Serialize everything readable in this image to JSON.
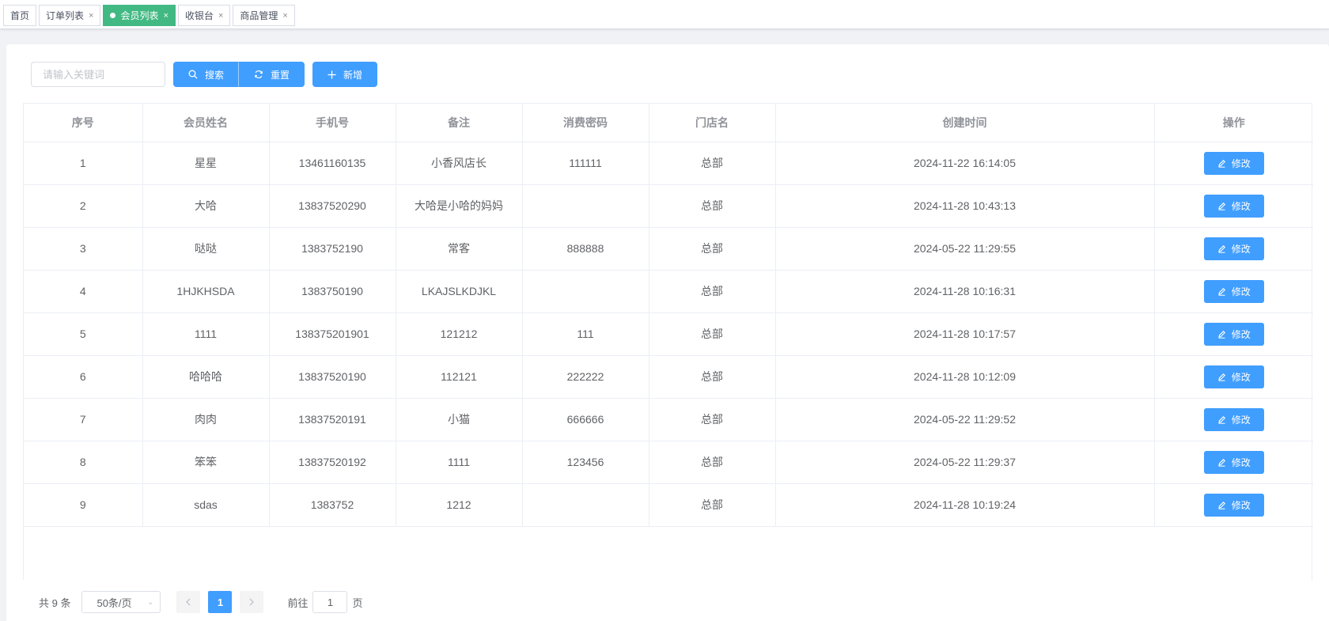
{
  "tabs": [
    {
      "label": "首页",
      "closable": false,
      "active": false
    },
    {
      "label": "订单列表",
      "closable": true,
      "active": false
    },
    {
      "label": "会员列表",
      "closable": true,
      "active": true
    },
    {
      "label": "收银台",
      "closable": true,
      "active": false
    },
    {
      "label": "商品管理",
      "closable": true,
      "active": false
    }
  ],
  "toolbar": {
    "search_placeholder": "请输入关键词",
    "search_label": "搜索",
    "reset_label": "重置",
    "add_label": "新增"
  },
  "table": {
    "headers": [
      "序号",
      "会员姓名",
      "手机号",
      "备注",
      "消费密码",
      "门店名",
      "创建时间",
      "操作"
    ],
    "edit_label": "修改",
    "rows": [
      [
        "1",
        "星星",
        "13461160135",
        "小香风店长",
        "111111",
        "总部",
        "2024-11-22 16:14:05"
      ],
      [
        "2",
        "大哈",
        "13837520290",
        "大哈是小哈的妈妈",
        "",
        "总部",
        "2024-11-28 10:43:13"
      ],
      [
        "3",
        "哒哒",
        "1383752190",
        "常客",
        "888888",
        "总部",
        "2024-05-22 11:29:55"
      ],
      [
        "4",
        "1HJKHSDA",
        "1383750190",
        "LKAJSLKDJKL",
        "",
        "总部",
        "2024-11-28 10:16:31"
      ],
      [
        "5",
        "1111",
        "138375201901",
        "121212",
        "111",
        "总部",
        "2024-11-28 10:17:57"
      ],
      [
        "6",
        "哈哈哈",
        "13837520190",
        "112121",
        "222222",
        "总部",
        "2024-11-28 10:12:09"
      ],
      [
        "7",
        "肉肉",
        "13837520191",
        "小猫",
        "666666",
        "总部",
        "2024-05-22 11:29:52"
      ],
      [
        "8",
        "笨笨",
        "13837520192",
        "1111",
        "123456",
        "总部",
        "2024-05-22 11:29:37"
      ],
      [
        "9",
        "sdas",
        "1383752",
        "1212",
        "",
        "总部",
        "2024-11-28 10:19:24"
      ]
    ]
  },
  "pagination": {
    "total_label": "共 9 条",
    "page_size": "50条/页",
    "current_page": "1",
    "goto_prefix": "前往",
    "goto_value": "1",
    "goto_suffix": "页"
  },
  "colors": {
    "primary": "#409eff",
    "active_tab": "#42b983"
  }
}
